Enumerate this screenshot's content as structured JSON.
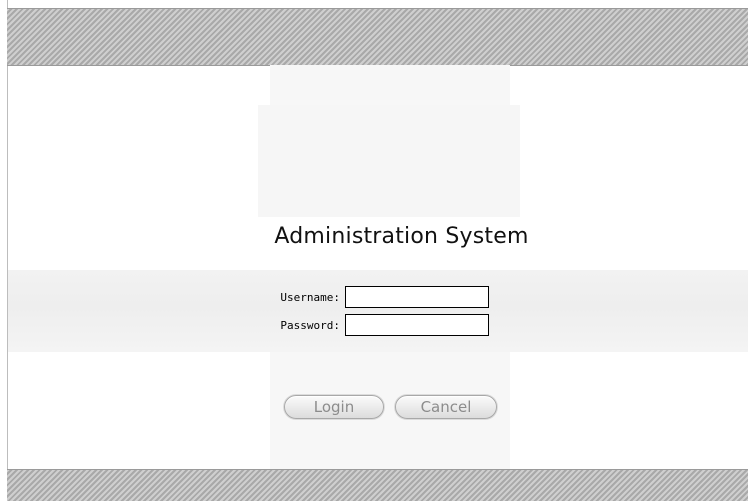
{
  "login_page": {
    "title": "Administration System",
    "username_label": "Username:",
    "password_label": "Password:",
    "username_value": "",
    "password_value": "",
    "login_button": "Login",
    "cancel_button": "Cancel"
  }
}
